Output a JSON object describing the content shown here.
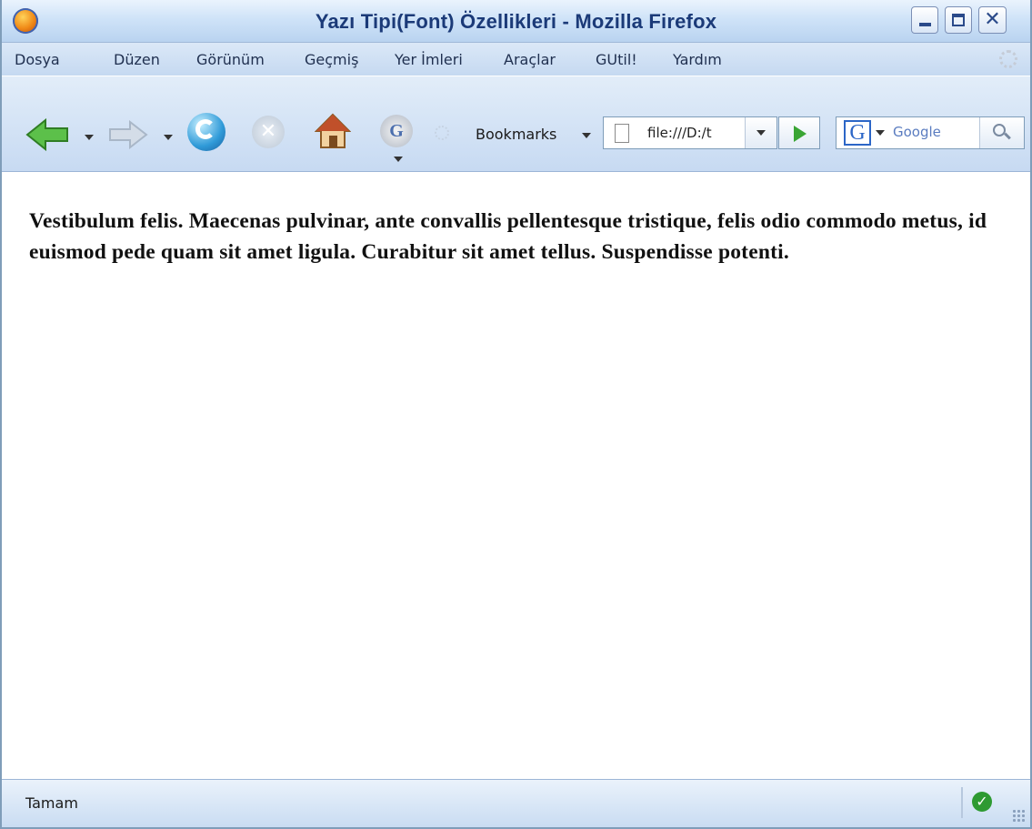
{
  "window": {
    "title": "Yazı Tipi(Font) Özellikleri - Mozilla Firefox",
    "icons": {
      "app": "firefox-icon",
      "minimize": "minimize-icon",
      "maximize": "maximize-icon",
      "close": "close-icon"
    }
  },
  "menubar": {
    "items": [
      "Dosya",
      "Düzen",
      "Görünüm",
      "Geçmiş",
      "Yer İmleri",
      "Araçlar",
      "GUtil!",
      "Yardım"
    ]
  },
  "toolbar": {
    "bookmarks_label": "Bookmarks",
    "url": "file:///D:/t",
    "search_placeholder": "Google",
    "search_engine": "G",
    "icons": [
      "back-icon",
      "forward-icon",
      "reload-icon",
      "stop-icon",
      "home-icon",
      "gutil-icon",
      "go-icon",
      "search-icon"
    ]
  },
  "content": {
    "paragraph": "Vestibulum felis. Maecenas pulvinar, ante convallis pellentesque tristique, felis odio commodo metus, id euismod pede quam sit amet ligula. Curabitur sit amet tellus. Suspendisse potenti."
  },
  "status": {
    "text": "Tamam"
  },
  "colors": {
    "chrome_light": "#dbe8f7",
    "chrome_dark": "#c5d9f1",
    "title_text": "#1b3a78",
    "content_bg": "#ffffff"
  }
}
